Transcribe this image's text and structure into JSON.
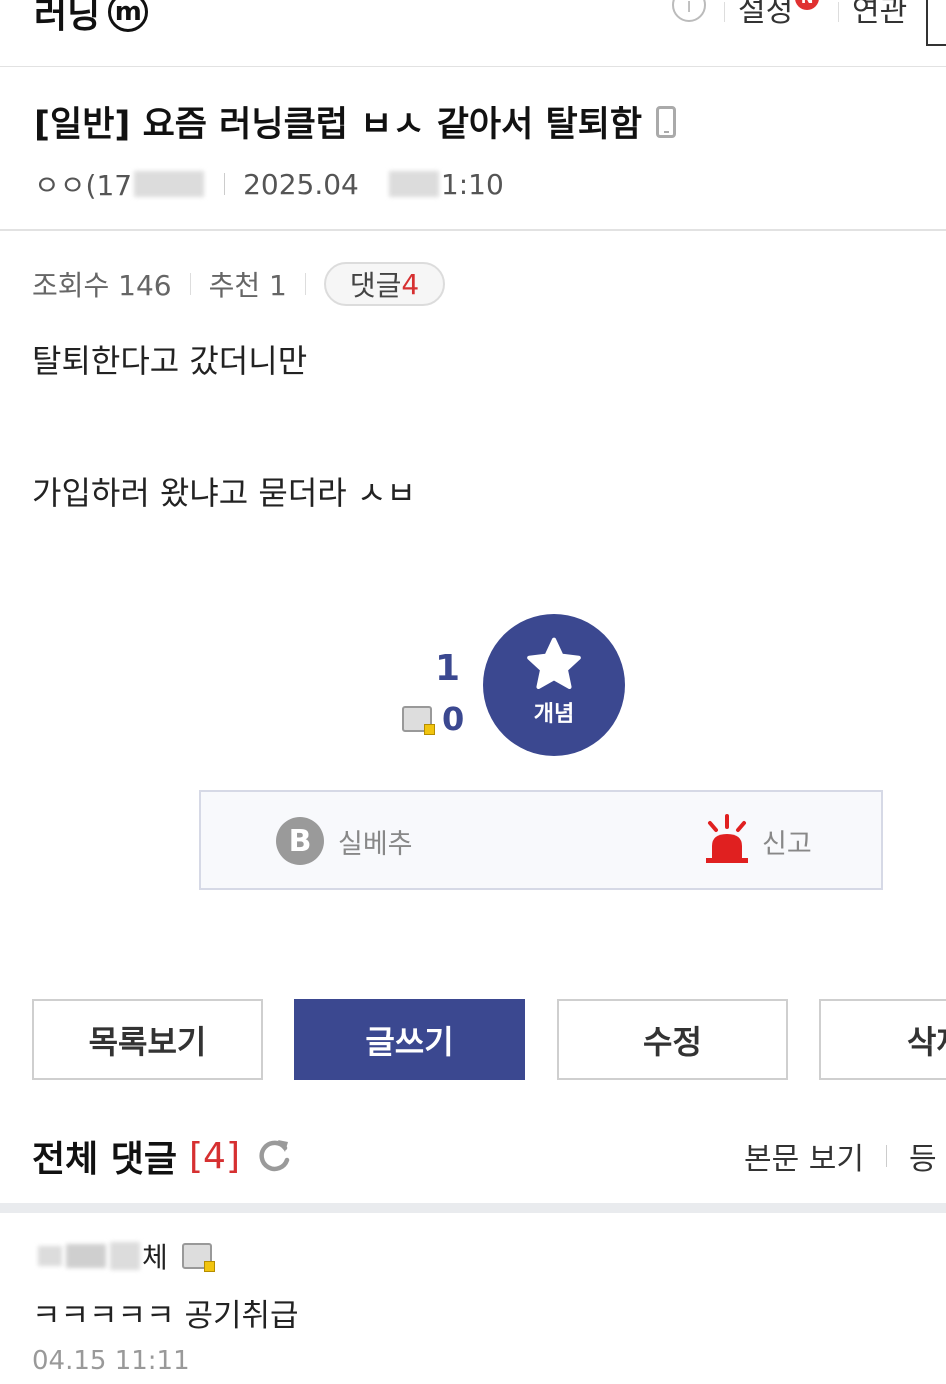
{
  "header": {
    "gallery_name": "러닝",
    "minor_badge": "m",
    "settings_label": "설정",
    "new_badge": "N",
    "related_label": "연관"
  },
  "post": {
    "title": "[일반] 요즘 러닝클럽 ㅂㅅ 같아서 탈퇴함",
    "author_prefix": "ㅇㅇ(17",
    "date": "2025.04",
    "time_suffix": "1:10",
    "views_label": "조회수 146",
    "recommend_label": "추천 1",
    "comment_pill_label": "댓글",
    "comment_pill_count": "4",
    "body_line_1": "탈퇴한다고 갔더니만",
    "body_line_2": "가입하러 왔냐고 묻더라 ㅅㅂ"
  },
  "recommend": {
    "up_count": "1",
    "fix_count": "0",
    "button_label": "개념"
  },
  "actions": {
    "b_letter": "B",
    "silbechu_label": "실베추",
    "report_label": "신고"
  },
  "buttons": {
    "list": "목록보기",
    "write": "글쓰기",
    "edit": "수정",
    "delete_partial": "삭제"
  },
  "comments": {
    "title": "전체 댓글",
    "count_label": "[4]",
    "view_body": "본문 보기",
    "register_partial": "등",
    "items": [
      {
        "author_suffix": "체",
        "text": "ㅋㅋㅋㅋㅋ 공기취급",
        "time": "04.15 11:11"
      }
    ]
  },
  "colors": {
    "primary": "#3b4890",
    "accent_red": "#d63031",
    "siren_red": "#e02020"
  }
}
